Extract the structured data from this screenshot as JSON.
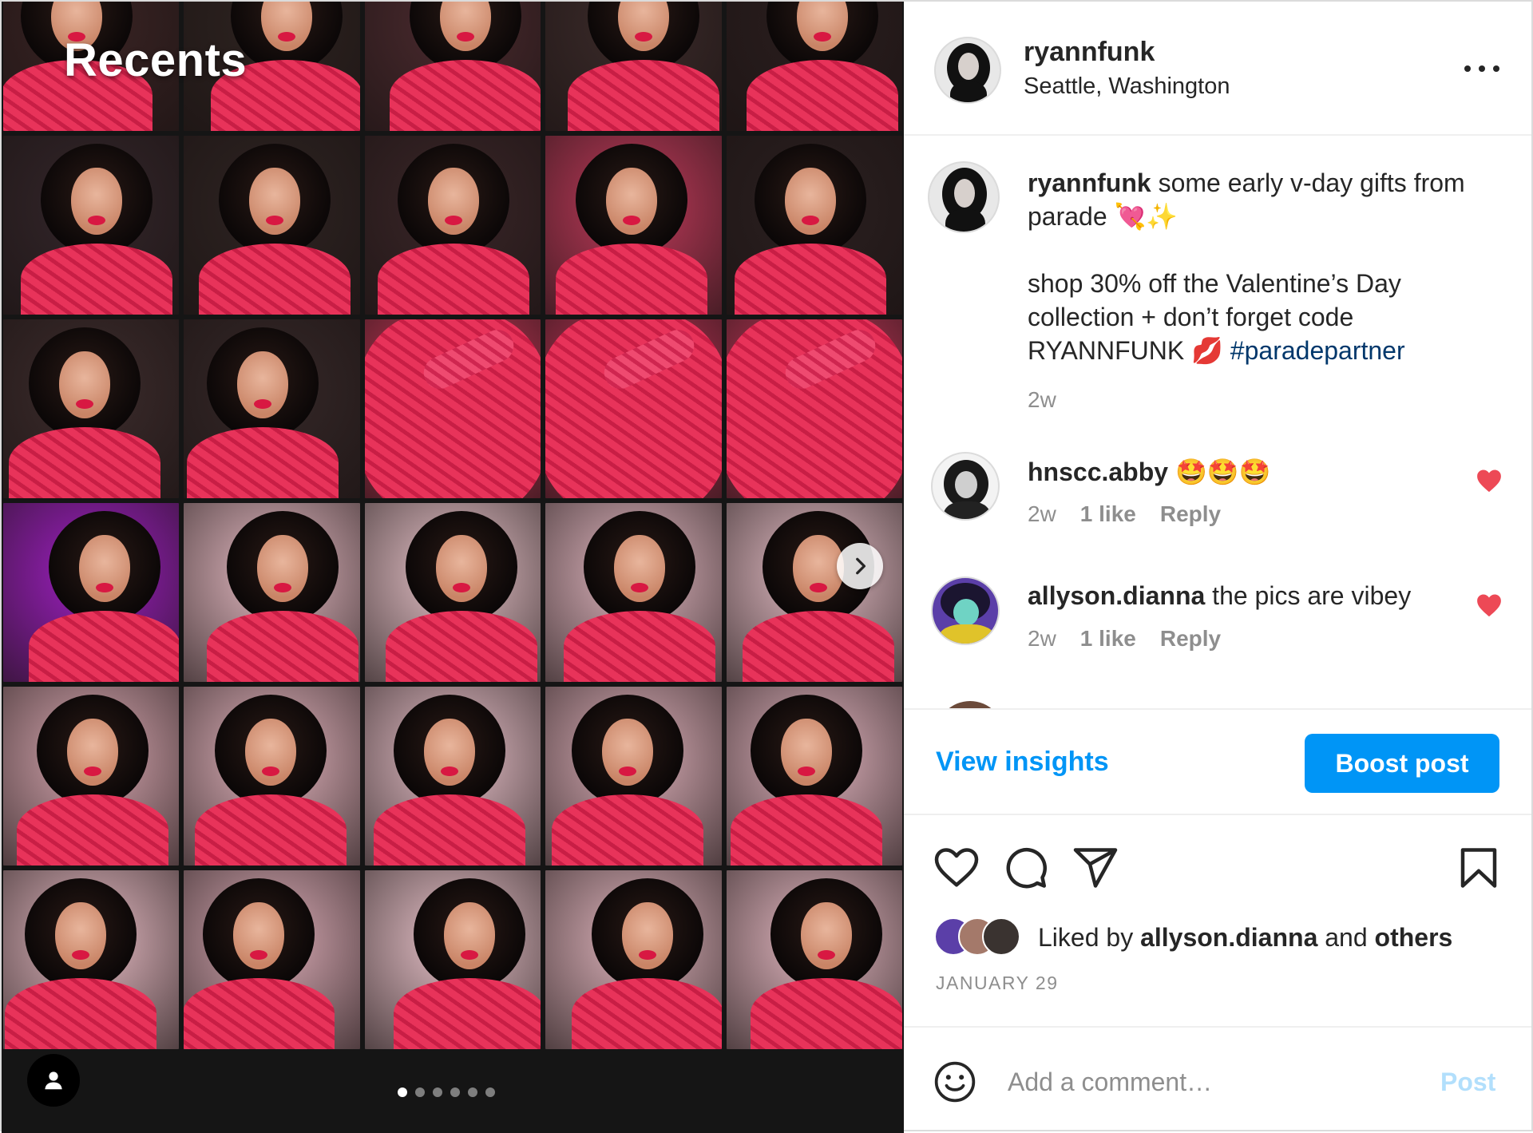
{
  "media": {
    "overlay_title": "Recents",
    "carousel": {
      "total": 6,
      "active": 0
    }
  },
  "header": {
    "username": "ryannfunk",
    "location": "Seattle, Washington"
  },
  "caption": {
    "username": "ryannfunk",
    "line1": "some early v-day gifts from parade 💘✨",
    "line2": "shop 30% off the Valentine’s Day collection + don’t forget code RYANNFUNK 💋",
    "hashtag": "#paradepartner",
    "time": "2w"
  },
  "comments": [
    {
      "username": "hnscc.abby",
      "text": "🤩🤩🤩",
      "time": "2w",
      "likes": "1 like",
      "reply": "Reply",
      "heart_color": "#ed4956"
    },
    {
      "username": "allyson.dianna",
      "text": "the pics are vibey",
      "time": "2w",
      "likes": "1 like",
      "reply": "Reply",
      "heart_color": "#ed4956"
    }
  ],
  "insights": {
    "view_label": "View insights",
    "boost_label": "Boost post"
  },
  "likes": {
    "prefix": "Liked by",
    "user": "allyson.dianna",
    "middle": "and",
    "others": "others"
  },
  "date": "JANUARY 29",
  "add_comment": {
    "placeholder": "Add a comment…",
    "post_label": "Post"
  },
  "colors": {
    "accent": "#0095f6",
    "link": "#00376b",
    "muted": "#8e8e8e",
    "like_red": "#ed4956"
  },
  "icons": [
    "more-options-icon",
    "chevron-right-icon",
    "user-tag-icon",
    "heart-icon",
    "comment-icon",
    "share-icon",
    "bookmark-icon",
    "emoji-icon"
  ]
}
